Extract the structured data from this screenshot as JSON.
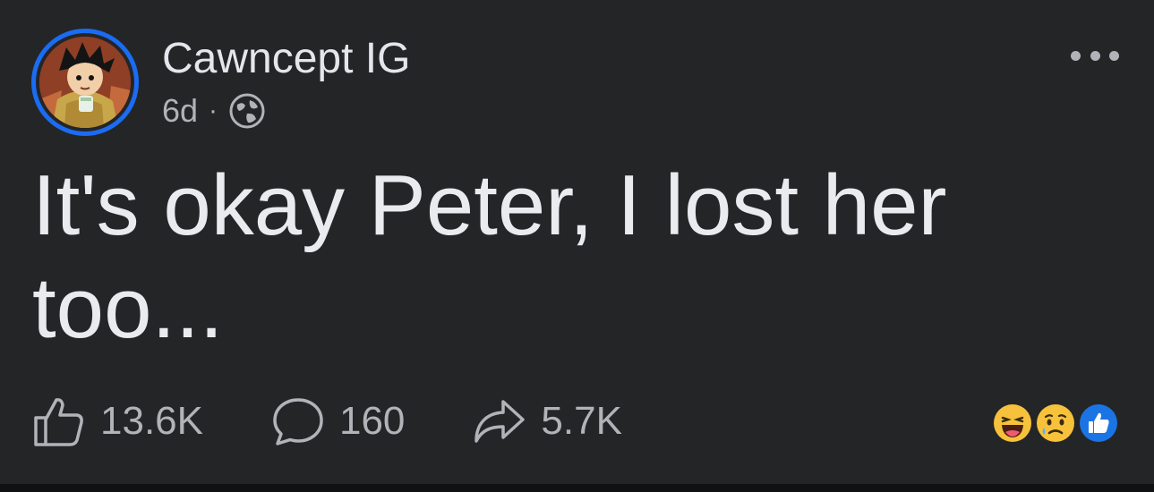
{
  "post": {
    "author": "Cawncept IG",
    "age": "6d",
    "separator": "·",
    "audience_icon": "globe-icon",
    "text": "It's okay Peter, I lost her too..."
  },
  "actions": {
    "like_count": "13.6K",
    "comment_count": "160",
    "share_count": "5.7K"
  },
  "reactions": [
    "haha-reaction-icon",
    "sad-reaction-icon",
    "like-reaction-icon"
  ],
  "colors": {
    "background": "#242527",
    "accent": "#1b6cf2",
    "primary_text": "#e4e6eb",
    "secondary_text": "#b0b3b8"
  }
}
